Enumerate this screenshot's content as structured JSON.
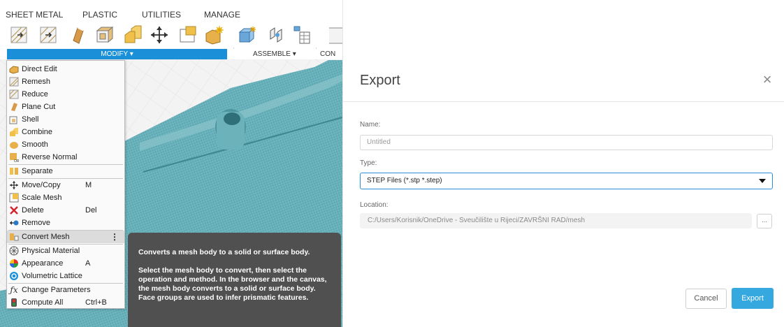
{
  "ribbon": {
    "tabs": [
      "SHEET METAL",
      "PLASTIC",
      "UTILITIES",
      "MANAGE"
    ],
    "groups": {
      "modify": "MODIFY ▾",
      "assemble": "ASSEMBLE ▾",
      "construct": "CON"
    }
  },
  "menu": {
    "items": [
      {
        "label": "Direct Edit",
        "shortcut": "",
        "icon": "direct-edit-icon"
      },
      {
        "label": "Remesh",
        "shortcut": "",
        "icon": "remesh-icon"
      },
      {
        "label": "Reduce",
        "shortcut": "",
        "icon": "reduce-icon"
      },
      {
        "label": "Plane Cut",
        "shortcut": "",
        "icon": "plane-cut-icon"
      },
      {
        "label": "Shell",
        "shortcut": "",
        "icon": "shell-icon"
      },
      {
        "label": "Combine",
        "shortcut": "",
        "icon": "combine-icon"
      },
      {
        "label": "Smooth",
        "shortcut": "",
        "icon": "smooth-icon"
      },
      {
        "label": "Reverse Normal",
        "shortcut": "",
        "icon": "reverse-normal-icon"
      },
      {
        "label": "Separate",
        "shortcut": "",
        "icon": "separate-icon"
      },
      {
        "label": "Move/Copy",
        "shortcut": "M",
        "icon": "move-icon"
      },
      {
        "label": "Scale Mesh",
        "shortcut": "",
        "icon": "scale-mesh-icon"
      },
      {
        "label": "Delete",
        "shortcut": "Del",
        "icon": "delete-icon"
      },
      {
        "label": "Remove",
        "shortcut": "",
        "icon": "remove-icon"
      },
      {
        "label": "Convert Mesh",
        "shortcut": "",
        "icon": "convert-mesh-icon"
      },
      {
        "label": "Physical Material",
        "shortcut": "",
        "icon": "physical-material-icon"
      },
      {
        "label": "Appearance",
        "shortcut": "A",
        "icon": "appearance-icon"
      },
      {
        "label": "Volumetric Lattice",
        "shortcut": "",
        "icon": "volumetric-lattice-icon"
      },
      {
        "label": "Change Parameters",
        "shortcut": "",
        "icon": "change-parameters-icon"
      },
      {
        "label": "Compute All",
        "shortcut": "Ctrl+B",
        "icon": "compute-all-icon"
      }
    ],
    "active_item": "Convert Mesh",
    "kebab": "⋮"
  },
  "tooltip": {
    "title": "Converts a mesh body to a solid or surface body.",
    "body": "Select the mesh body to convert, then select the operation and method. In the browser and the canvas, the mesh body converts to a solid or surface body. Face groups are used to infer prismatic features."
  },
  "dialog": {
    "title": "Export",
    "close": "×",
    "name_label": "Name:",
    "name_placeholder": "Untitled",
    "type_label": "Type:",
    "type_value": "STEP Files (*.stp *.step)",
    "location_label": "Location:",
    "location_value": "C:/Users/Korisnik/OneDrive - Sveučilište u Rijeci/ZAVRŠNI RAD/mesh",
    "browse_label": "...",
    "cancel_label": "Cancel",
    "export_label": "Export"
  },
  "colors": {
    "accent": "#1b8fd8",
    "export_button": "#35a8e0",
    "mesh": "#5aa6b0",
    "tooltip_bg": "#505050"
  }
}
